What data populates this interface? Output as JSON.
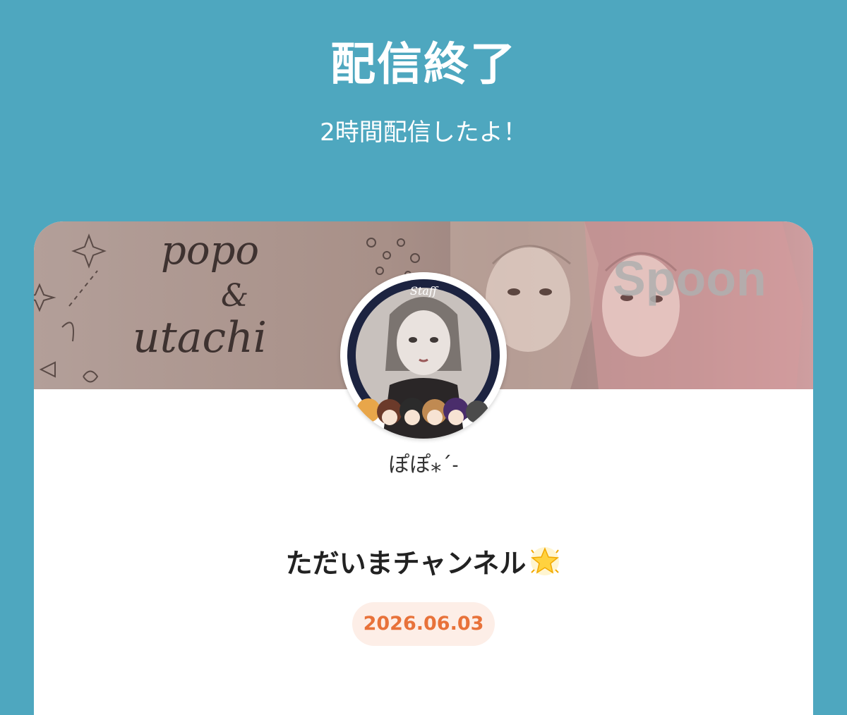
{
  "header": {
    "title": "配信終了",
    "subtitle": "2時間配信したよ！"
  },
  "banner": {
    "script_line1": "popo",
    "script_line2": "&",
    "script_line3": "utachi",
    "brand_logo": "Spoon",
    "avatar_caption": "Staff"
  },
  "profile": {
    "username": "ぽぽ⁎ˊ˗"
  },
  "broadcast": {
    "title": "ただいまチャンネル",
    "title_icon": "glowing-star-icon",
    "date": "2026.06.03"
  },
  "colors": {
    "background": "#4ea7bf",
    "card": "#ffffff",
    "date_text": "#e8723a",
    "date_badge": "#fdeee7"
  }
}
